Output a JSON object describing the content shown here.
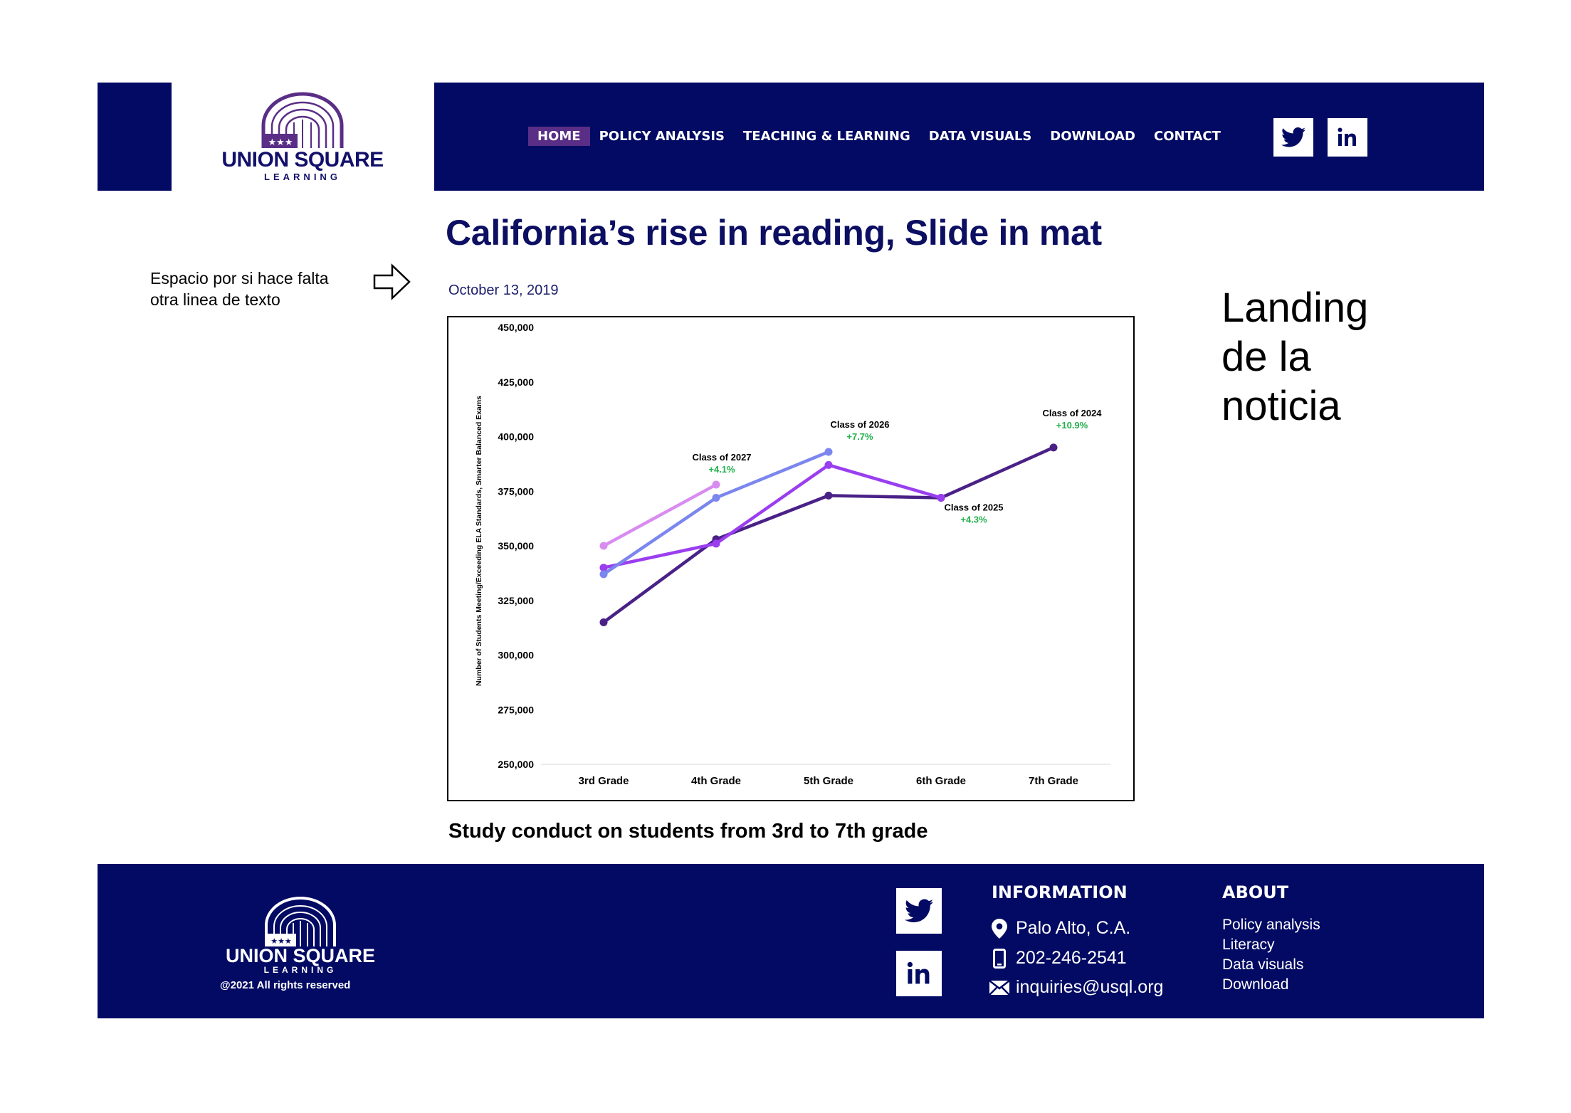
{
  "brand": {
    "name": "UNION SQUARE",
    "sub": "LEARNING",
    "color_primary": "#020a63",
    "color_accent": "#5a2e86"
  },
  "nav": {
    "items": [
      {
        "label": "HOME",
        "active": true
      },
      {
        "label": "POLICY ANALYSIS",
        "active": false
      },
      {
        "label": "TEACHING & LEARNING",
        "active": false
      },
      {
        "label": "DATA VISUALS",
        "active": false
      },
      {
        "label": "DOWNLOAD",
        "active": false
      },
      {
        "label": "CONTACT",
        "active": false
      }
    ],
    "social": [
      "twitter-icon",
      "linkedin-icon"
    ]
  },
  "article": {
    "title": "California’s rise in reading, Slide in mat",
    "date": "October 13, 2019",
    "caption": "Study conduct on students from 3rd to 7th grade"
  },
  "annotations": {
    "note_line1": "Espacio por si hace falta",
    "note_line2": "otra linea de texto",
    "landing_line1": "Landing",
    "landing_line2": "de la",
    "landing_line3": "noticia"
  },
  "chart_data": {
    "type": "line",
    "ylabel": "Number of Students Meeting/Exceeding ELA Standards,  Smarter Balanced Exams",
    "categories": [
      "3rd Grade",
      "4th Grade",
      "5th Grade",
      "6th Grade",
      "7th Grade"
    ],
    "ylim": [
      250000,
      450000
    ],
    "yticks": [
      250000,
      275000,
      300000,
      325000,
      350000,
      375000,
      400000,
      425000,
      450000
    ],
    "ytick_labels": [
      "250,000",
      "275,000",
      "300,000",
      "325,000",
      "350,000",
      "375,000",
      "400,000",
      "425,000",
      "450,000"
    ],
    "grid": false,
    "series": [
      {
        "name": "Class of 2024",
        "change": "+10.9%",
        "color": "#4a2187",
        "values": [
          315000,
          353000,
          373000,
          372000,
          395000
        ]
      },
      {
        "name": "Class of 2025",
        "change": "+4.3%",
        "color": "#9a3ef0",
        "values": [
          340000,
          351000,
          387000,
          372000,
          null
        ]
      },
      {
        "name": "Class of 2026",
        "change": "+7.7%",
        "color": "#7b86ee",
        "values": [
          337000,
          372000,
          393000,
          null,
          null
        ]
      },
      {
        "name": "Class of 2027",
        "change": "+4.1%",
        "color": "#d88cf0",
        "values": [
          350000,
          378000,
          null,
          null,
          null
        ]
      }
    ],
    "label_color": "#000000",
    "change_color": "#22b14c"
  },
  "footer": {
    "copyright": "@2021 All rights reserved",
    "info_heading": "INFORMATION",
    "location": "Palo Alto, C.A.",
    "phone": "202-246-2541",
    "email": "inquiries@usql.org",
    "about_heading": "ABOUT",
    "about_links": [
      "Policy analysis",
      "Literacy",
      "Data visuals",
      "Download"
    ]
  }
}
